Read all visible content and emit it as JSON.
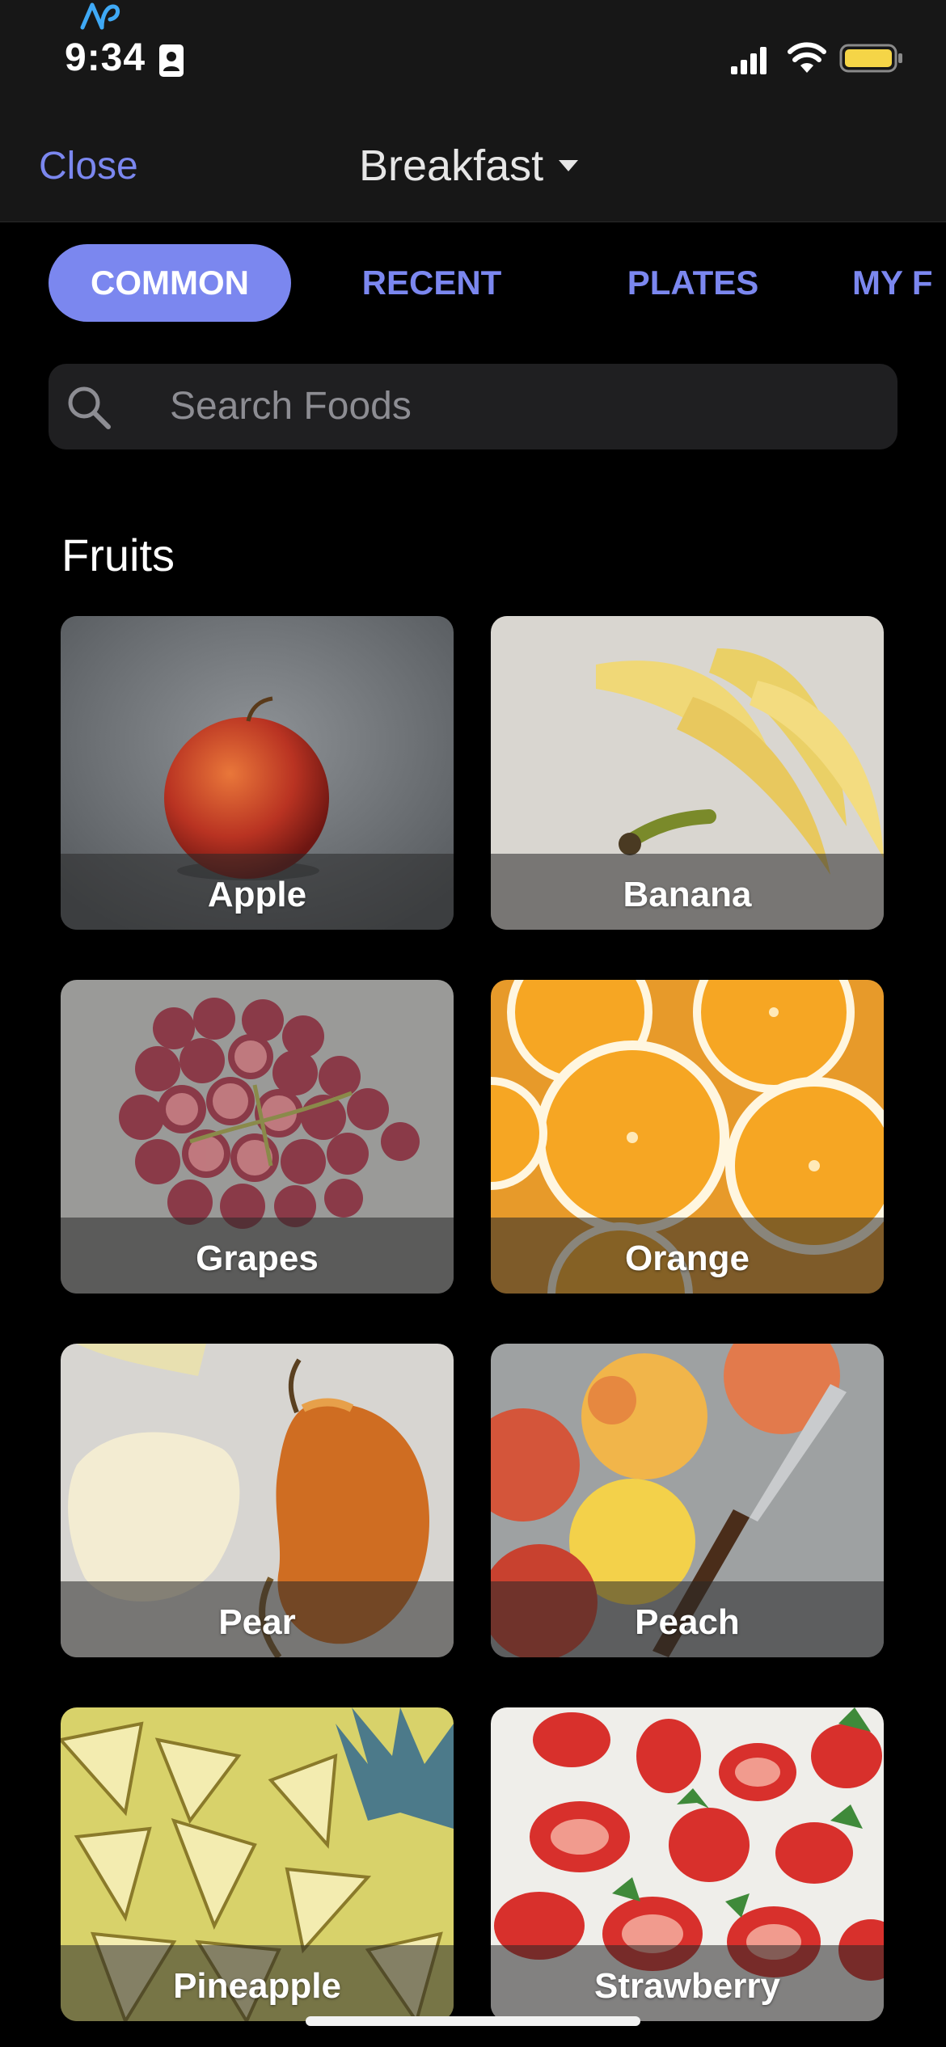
{
  "status_bar": {
    "time": "9:34",
    "icons": [
      "app-logo-icon",
      "id-card-icon",
      "signal-icon",
      "wifi-icon",
      "battery-icon"
    ],
    "battery_color": "#f5d547"
  },
  "nav": {
    "close_label": "Close",
    "meal_title": "Breakfast",
    "accent_color": "#7b87ef"
  },
  "tabs": [
    {
      "label": "COMMON",
      "active": true
    },
    {
      "label": "RECENT",
      "active": false
    },
    {
      "label": "PLATES",
      "active": false
    },
    {
      "label": "MY F",
      "active": false
    }
  ],
  "search": {
    "placeholder": "Search Foods"
  },
  "section": {
    "title": "Fruits"
  },
  "foods": [
    {
      "name": "Apple"
    },
    {
      "name": "Banana"
    },
    {
      "name": "Grapes"
    },
    {
      "name": "Orange"
    },
    {
      "name": "Pear"
    },
    {
      "name": "Peach"
    },
    {
      "name": "Pineapple"
    },
    {
      "name": "Strawberry"
    }
  ]
}
